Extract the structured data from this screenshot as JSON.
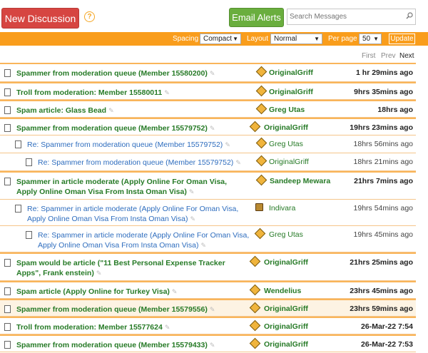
{
  "toolbar": {
    "new_discussion": "New Discussion",
    "help": "?",
    "email_alerts": "Email Alerts",
    "search_placeholder": "Search Messages"
  },
  "options": {
    "spacing_label": "Spacing",
    "spacing_value": "Compact",
    "layout_label": "Layout",
    "layout_value": "Normal",
    "perpage_label": "Per page",
    "perpage_value": "50",
    "update": "Update"
  },
  "pager": {
    "first": "First",
    "prev": "Prev",
    "next": "Next"
  },
  "colors": {
    "accent_orange": "#f99d1c",
    "new_button": "#d64541",
    "email_button": "#6aae3e",
    "topic_green": "#267a26",
    "reply_blue": "#2e6dbe"
  },
  "messages": [
    {
      "subject": "Spammer from moderation queue (Member 15580200)",
      "author": "OriginalGriff",
      "time": "1 hr 29mins ago",
      "avatar": "diamond-icon"
    },
    {
      "subject": "Troll from moderation: Member 15580011",
      "author": "OriginalGriff",
      "time": "9hrs 35mins ago",
      "avatar": "diamond-icon"
    },
    {
      "subject": "Spam article: Glass Bead",
      "author": "Greg Utas",
      "time": "18hrs ago",
      "avatar": "diamond-icon"
    },
    {
      "subject": "Spammer from moderation queue (Member 15579752)",
      "author": "OriginalGriff",
      "time": "19hrs 23mins ago",
      "avatar": "diamond-icon"
    },
    {
      "subject": "Re: Spammer from moderation queue (Member 15579752)",
      "author": "Greg Utas",
      "time": "18hrs 56mins ago",
      "avatar": "diamond-icon"
    },
    {
      "subject": "Re: Spammer from moderation queue (Member 15579752)",
      "author": "OriginalGriff",
      "time": "18hrs 21mins ago",
      "avatar": "diamond-icon"
    },
    {
      "subject_line1": "Spammer in article moderate (Apply Online For Oman Visa,",
      "subject_line2": "Apply Online Oman Visa From Insta Oman Visa)",
      "author": "Sandeep Mewara",
      "time": "21hrs 7mins ago",
      "avatar": "diamond-icon"
    },
    {
      "subject_line1": "Re: Spammer in article moderate (Apply Online For Oman Visa,",
      "subject_line2": "Apply Online Oman Visa From Insta Oman Visa)",
      "author": "Indivara",
      "time": "19hrs 54mins ago",
      "avatar": "photo-avatar-icon"
    },
    {
      "subject_line1": "Re: Spammer in article moderate (Apply Online For Oman Visa,",
      "subject_line2": "Apply Online Oman Visa From Insta Oman Visa)",
      "author": "Greg Utas",
      "time": "19hrs 45mins ago",
      "avatar": "diamond-icon"
    },
    {
      "subject_line1": "Spam would be article (\"11 Best Personal Expense Tracker",
      "subject_line2": "Apps\", Frank enstein)",
      "author": "OriginalGriff",
      "time": "21hrs 25mins ago",
      "avatar": "diamond-icon"
    },
    {
      "subject": "Spam article (Apply Online for Turkey Visa)",
      "author": "Wendelius",
      "time": "23hrs 45mins ago",
      "avatar": "diamond-icon"
    },
    {
      "subject": "Spammer from moderation queue (Member 15579556)",
      "author": "OriginalGriff",
      "time": "23hrs 59mins ago",
      "avatar": "diamond-icon"
    },
    {
      "subject": "Troll from moderation: Member 15577624",
      "author": "OriginalGriff",
      "time": "26-Mar-22 7:54",
      "avatar": "diamond-icon"
    },
    {
      "subject": "Spammer from moderation queue (Member 15579433)",
      "author": "OriginalGriff",
      "time": "26-Mar-22 7:53",
      "avatar": "diamond-icon"
    }
  ]
}
